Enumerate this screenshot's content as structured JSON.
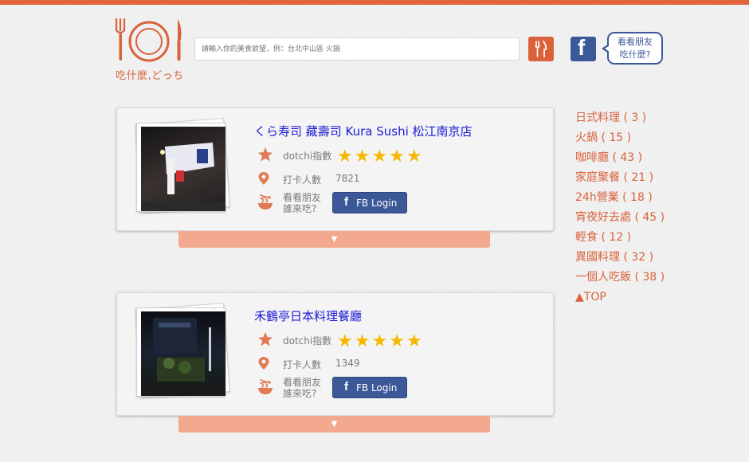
{
  "header": {
    "logo_text": "吃什麼,どっち",
    "search_placeholder": "請輸入你的美食欲望，例：台北中山區 火鍋",
    "fb_icon": "f",
    "bubble_line1": "看看朋友",
    "bubble_line2": "吃什麼?"
  },
  "labels": {
    "dotchi_index": "dotchi指數",
    "checkin": "打卡人數",
    "friends_line1": "看看朋友",
    "friends_line2": "誰來吃?",
    "fb_login": "FB Login",
    "fb_f": "f",
    "expand_arrow": "▼",
    "star": "★"
  },
  "restaurants": [
    {
      "name": "くら寿司 藏壽司 Kura Sushi 松江南京店",
      "rating": 5,
      "checkins": "7821"
    },
    {
      "name": "禾鶴亭日本料理餐廳",
      "rating": 5,
      "checkins": "1349"
    }
  ],
  "sidebar": {
    "categories": [
      "日式料理 ( 3 )",
      "火鍋 ( 15 )",
      "咖啡廳 ( 43 )",
      "家庭聚餐 ( 21 )",
      "24h營業 ( 18 )",
      "宵夜好去處 ( 45 )",
      "輕食 ( 12 )",
      "異國料理 ( 32 )",
      "一個人吃飯 ( 38 )"
    ],
    "top": "▲TOP"
  },
  "colors": {
    "accent": "#e0633a",
    "fb_blue": "#3b5998",
    "link_blue": "#1a1ad6",
    "star": "#f5b800",
    "expand": "#f2a98e"
  }
}
